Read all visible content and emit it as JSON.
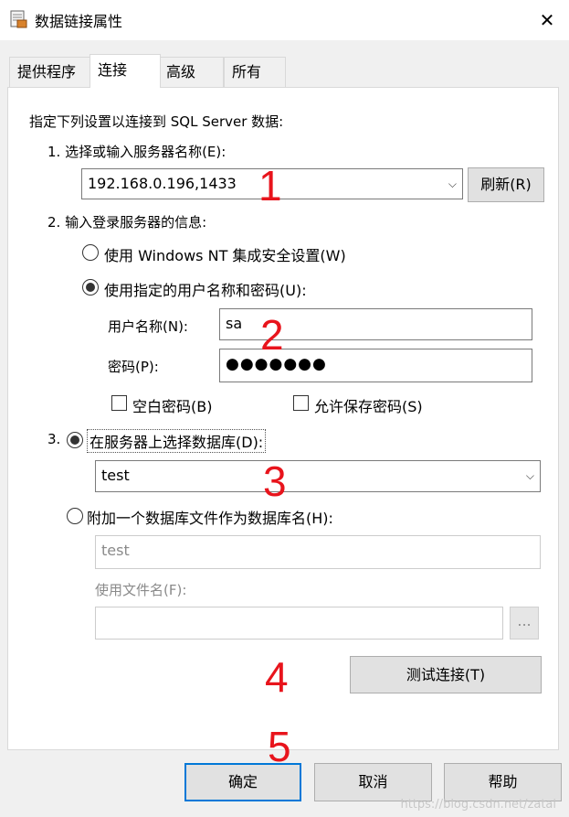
{
  "window": {
    "title": "数据链接属性",
    "close_glyph": "✕",
    "icon": "data-link-properties-icon"
  },
  "tabs": [
    {
      "label": "提供程序",
      "active": false
    },
    {
      "label": "连接",
      "active": true
    },
    {
      "label": "高级",
      "active": false
    },
    {
      "label": "所有",
      "active": false
    }
  ],
  "connection": {
    "intro": "指定下列设置以连接到 SQL Server 数据:",
    "step1_label": "1. 选择或输入服务器名称(E):",
    "server_value": "192.168.0.196,1433",
    "refresh_label": "刷新(R)",
    "step2_label": "2. 输入登录服务器的信息:",
    "radio_windows_nt": "使用 Windows NT 集成安全设置(W)",
    "radio_user_password": "使用指定的用户名称和密码(U):",
    "username_label": "用户名称(N):",
    "username_value": "sa",
    "password_label": "密码(P):",
    "password_value": "●●●●●●●",
    "blank_password": "空白密码(B)",
    "allow_save_password": "允许保存密码(S)",
    "step3_number": "3.",
    "radio_select_db": "在服务器上选择数据库(D):",
    "database_value": "test",
    "radio_attach_file": "附加一个数据库文件作为数据库名(H):",
    "attach_db_value": "test",
    "file_name_label": "使用文件名(F):",
    "file_name_value": "",
    "browse_label": "...",
    "test_connection_label": "测试连接(T)"
  },
  "footer": {
    "ok_label": "确定",
    "cancel_label": "取消",
    "help_label": "帮助"
  },
  "annotations": [
    "1",
    "2",
    "3",
    "4",
    "5"
  ],
  "watermark": "https://blog.csdn.net/zatai"
}
